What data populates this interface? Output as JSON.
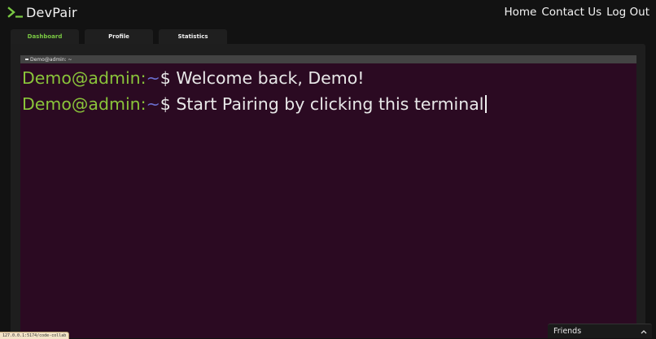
{
  "header": {
    "logo_text": "DevPair",
    "nav": {
      "home": "Home",
      "contact": "Contact Us",
      "logout": "Log Out"
    }
  },
  "tabs": [
    {
      "label": "Dashboard",
      "active": true
    },
    {
      "label": "Profile",
      "active": false
    },
    {
      "label": "Statistics",
      "active": false
    }
  ],
  "terminal": {
    "title": "Demo@admin: ~",
    "lines": [
      {
        "user": "Demo@admin:",
        "path": "~",
        "sign": "$",
        "text": "Welcome back, Demo!"
      },
      {
        "user": "Demo@admin:",
        "path": "~",
        "sign": "$",
        "text": "Start Pairing by clicking this terminal"
      }
    ]
  },
  "status_url": "127.0.0.1:5174/code-collab",
  "friends": {
    "label": "Friends"
  },
  "colors": {
    "accent_green": "#7ac943",
    "terminal_bg": "#2b0a22",
    "path_blue": "#6b6fd0"
  }
}
